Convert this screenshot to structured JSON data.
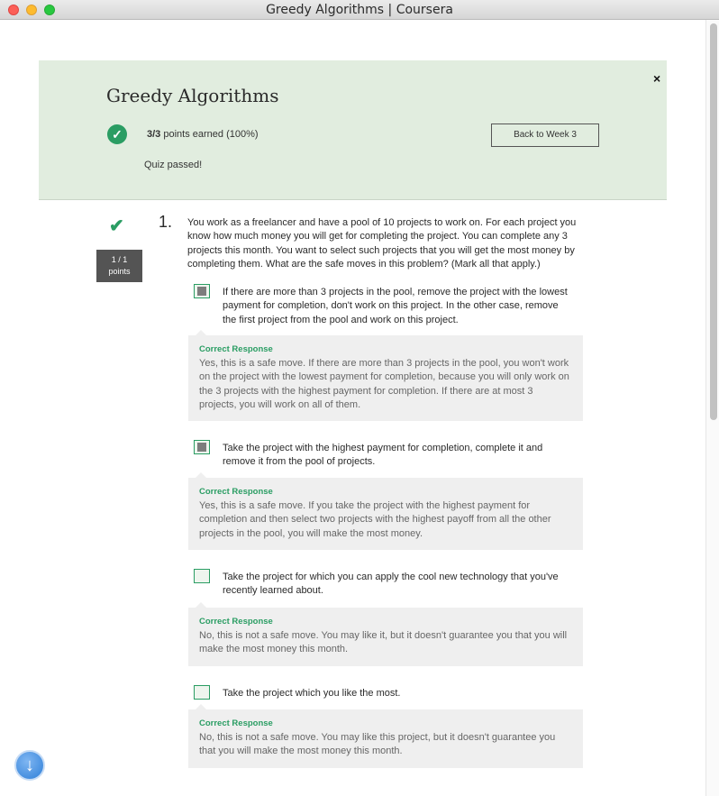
{
  "window": {
    "title": "Greedy Algorithms | Coursera"
  },
  "header": {
    "title": "Greedy Algorithms",
    "close_label": "×",
    "score": "3/3",
    "score_suffix": "points earned (100%)",
    "back_button": "Back to Week 3",
    "status": "Quiz passed!"
  },
  "question": {
    "number": "1.",
    "score_line1": "1 / 1",
    "score_line2": "points",
    "text": "You work as a freelancer and have a pool of 10 projects to work on. For each project you know how much money you will get for completing the project. You can complete any 3 projects this month. You want to select such projects that you will get the most money by completing them. What are the safe moves in this problem? (Mark all that apply.)",
    "options": [
      {
        "checked": true,
        "text": "If there are more than 3 projects in the pool, remove the project with the lowest payment for completion, don't work on this project. In the other case, remove the first project from the pool and work on this project.",
        "feedback_title": "Correct Response",
        "feedback": "Yes, this is a safe move. If there are more than 3 projects in the pool, you won't work on the project with the lowest payment for completion, because you will only work on the 3 projects with the highest payment for completion. If there are at most 3 projects, you will work on all of them."
      },
      {
        "checked": true,
        "text": "Take the project with the highest payment for completion, complete it and remove it from the pool of projects.",
        "feedback_title": "Correct Response",
        "feedback": "Yes, this is a safe move. If you take the project with the highest payment for completion and then select two projects with the highest payoff from all the other projects in the pool, you will make the most money."
      },
      {
        "checked": false,
        "text": "Take the project for which you can apply the cool new technology that you've recently learned about.",
        "feedback_title": "Correct Response",
        "feedback": "No, this is not a safe move. You may like it, but it doesn't guarantee you that you will make the most money this month."
      },
      {
        "checked": false,
        "text": "Take the project which you like the most.",
        "feedback_title": "Correct Response",
        "feedback": "No, this is not a safe move. You may like this project, but it doesn't guarantee you that you will make the most money this month."
      }
    ]
  },
  "colors": {
    "accent": "#2a9d63",
    "header_bg": "#e1eddf",
    "feedback_bg": "#efefef"
  }
}
